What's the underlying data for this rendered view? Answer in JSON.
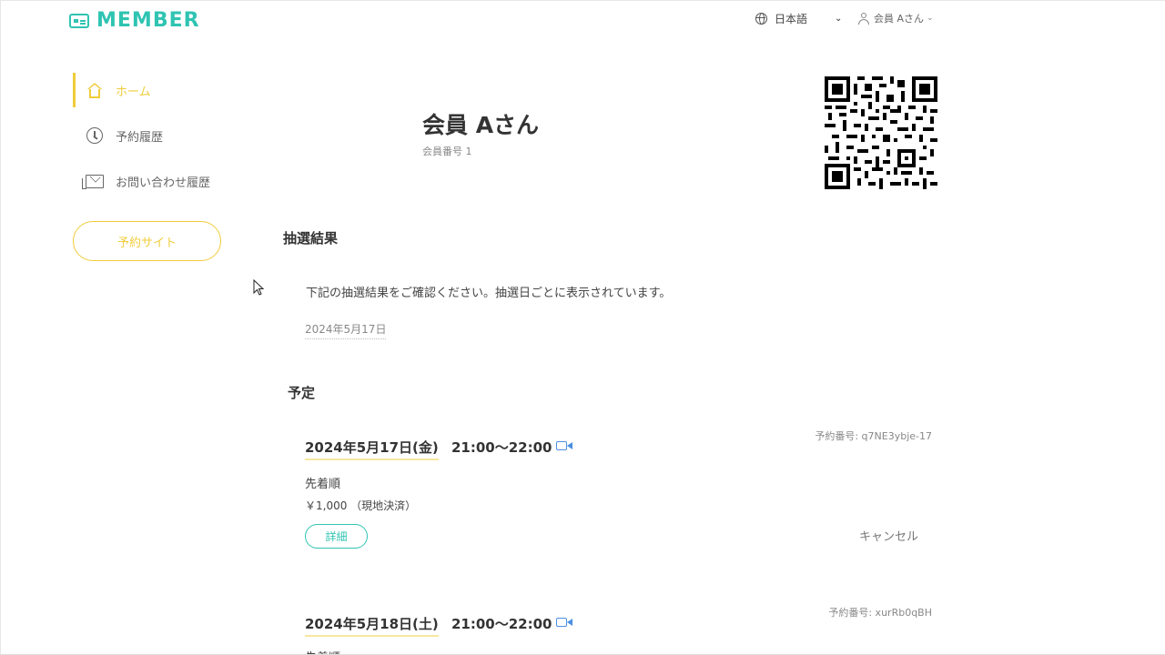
{
  "header": {
    "logo_text": "MEMBER",
    "language": "日本語",
    "user_name": "会員 Aさん"
  },
  "sidebar": {
    "items": [
      {
        "label": "ホーム",
        "icon": "home-icon",
        "active": true
      },
      {
        "label": "予約履歴",
        "icon": "clock-icon",
        "active": false
      },
      {
        "label": "お問い合わせ履歴",
        "icon": "mail-icon",
        "active": false
      }
    ],
    "reserve_site_label": "予約サイト"
  },
  "member": {
    "name": "会員 Aさん",
    "number_label": "会員番号 1"
  },
  "lottery": {
    "title": "抽選結果",
    "description": "下記の抽選結果をご確認ください。抽選日ごとに表示されています。",
    "date": "2024年5月17日"
  },
  "schedule": {
    "title": "予定",
    "reservations": [
      {
        "date": "2024年5月17日(金)",
        "time": "21:00〜22:00",
        "number": "予約番号: q7NE3ybje-17",
        "type": "先着順",
        "price": "￥1,000 （現地決済）",
        "detail_label": "詳細",
        "cancel_label": "キャンセル"
      },
      {
        "date": "2024年5月18日(土)",
        "time": "21:00〜22:00",
        "number": "予約番号: xurRb0qBH",
        "type": "先着順"
      }
    ]
  },
  "colors": {
    "brand_teal": "#2fc4b2",
    "accent_yellow": "#f0cc3c",
    "video_blue": "#4a90e2"
  }
}
